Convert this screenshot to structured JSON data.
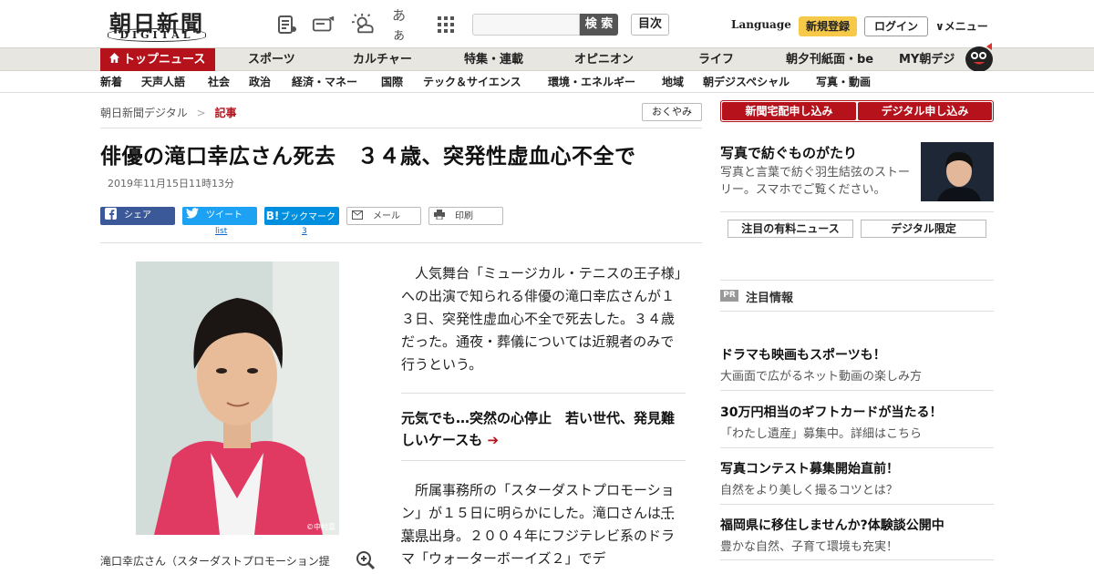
{
  "header": {
    "logo": "朝日新聞",
    "logo_sub": "DIGITAL",
    "search_button": "検 索",
    "contents_button": "目次",
    "language": "Language",
    "register": "新規登録",
    "login": "ログイン",
    "menu": "∨メニュー",
    "kana_icon": "あぁ"
  },
  "gnav": {
    "top": "トップニュース",
    "items": [
      "スポーツ",
      "カルチャー",
      "特集・連載",
      "オピニオン",
      "ライフ",
      "朝夕刊紙面・be",
      "MY朝デジ"
    ]
  },
  "snav": {
    "items": [
      "新着",
      "天声人語",
      "社会",
      "政治",
      "経済・マネー",
      "国際",
      "テック＆サイエンス",
      "環境・エネルギー",
      "地域",
      "朝デジスペシャル",
      "写真・動画"
    ]
  },
  "breadcrumb": {
    "home": "朝日新聞デジタル",
    "sep": ">",
    "current": "記事"
  },
  "okuyami": "おくやみ",
  "article": {
    "headline": "俳優の滝口幸広さん死去　３４歳、突発性虚血心不全で",
    "date": "2019年11月15日11時13分",
    "photo_credit": "©中村嘉",
    "caption": "滝口幸広さん（スターダストプロモーション提",
    "paragraph1": "人気舞台「ミュージカル・テニスの王子様」への出演で知られる俳優の滝口幸広さんが１３日、突発性虚血心不全で死去した。３４歳だった。通夜・葬儀については近親者のみで行うという。",
    "related": "元気でも…突然の心停止　若い世代、発見難しいケースも",
    "paragraph2_a": "所属事務所の「スターダストプロモーション」が１５日に明らかにした。滝口さんは",
    "paragraph2_link": "千葉県",
    "paragraph2_b": "出身。２００４年にフジテレビ系のドラマ「ウォーターボーイズ２」でデ"
  },
  "share": {
    "facebook": "シェア",
    "twitter": "ツイート",
    "twitter_sub": "list",
    "hatena": "ブックマーク",
    "hatena_sub": "3",
    "mail": "メール",
    "print": "印刷"
  },
  "sidebar": {
    "btn_home_delivery": "新聞宅配申し込み",
    "btn_digital": "デジタル申し込み",
    "feature_title": "写真で紡ぐものがたり",
    "feature_text": "写真と言葉で紡ぐ羽生結弦のストーリー。スマホでご覧ください。",
    "tab_paid": "注目の有料ニュース",
    "tab_digital": "デジタル限定",
    "pr_badge": "PR",
    "pr_label": "注目情報",
    "pr_items": [
      {
        "title": "ドラマも映画もスポーツも！",
        "sub": "大画面で広がるネット動画の楽しみ方"
      },
      {
        "title": "30万円相当のギフトカードが当たる！",
        "sub": "「わたし遺産」募集中。詳細はこちら"
      },
      {
        "title": "写真コンテスト募集開始直前！",
        "sub": "自然をより美しく撮るコツとは？"
      },
      {
        "title": "福岡県に移住しませんか?体験談公開中",
        "sub": "豊かな自然、子育て環境も充実！"
      }
    ]
  },
  "colors": {
    "brand_red": "#b5121b",
    "register_yellow": "#f7c948",
    "facebook": "#3b5998",
    "twitter": "#1da1f2",
    "hatena": "#008fde"
  }
}
